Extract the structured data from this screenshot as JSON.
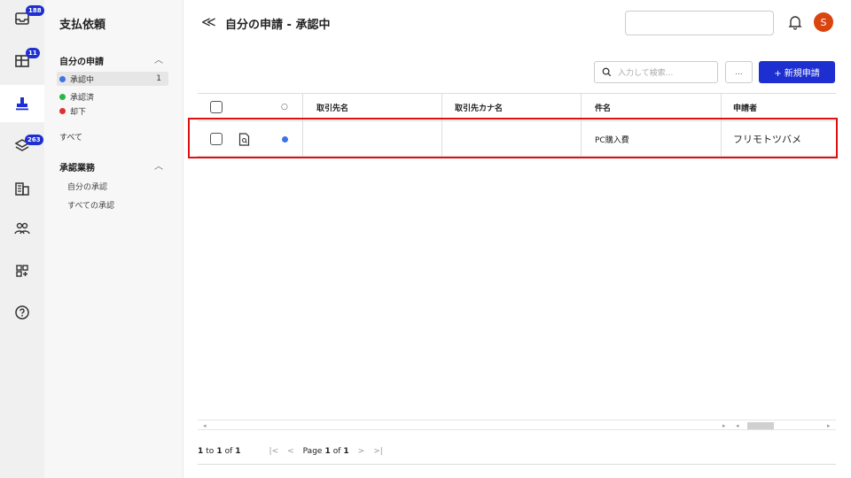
{
  "rail": {
    "badges": {
      "inbox": "188",
      "grid": "11",
      "layers": "263"
    }
  },
  "sidebar": {
    "title": "支払依頼",
    "section1": "自分の申請",
    "items": [
      {
        "label": "承認中",
        "count": "1",
        "color": "#3b73e8"
      },
      {
        "label": "承認済",
        "count": "",
        "color": "#2db34a"
      },
      {
        "label": "却下",
        "count": "",
        "color": "#e03030"
      }
    ],
    "all": "すべて",
    "section2": "承認業務",
    "sub": [
      "自分の承認",
      "すべての承認"
    ]
  },
  "header": {
    "back": "≪",
    "title": "自分の申請 - 承認中",
    "avatar": "S"
  },
  "toolbar": {
    "search_placeholder": "入力して検索...",
    "more": "...",
    "new_button": "+ 新規申請"
  },
  "table": {
    "columns": [
      "取引先名",
      "取引先カナ名",
      "件名",
      "申請者"
    ],
    "status_header": "○",
    "rows": [
      {
        "partner": "",
        "partner_kana": "",
        "subject": "PC購入費",
        "applicant": "フリモトツバメ",
        "status_color": "#3b73e8"
      }
    ]
  },
  "pager": {
    "range_a": "1",
    "range_to": "to",
    "range_b": "1",
    "range_of": "of",
    "range_total": "1",
    "first": "|<",
    "prev": "<",
    "page_label": "Page",
    "page_num": "1",
    "page_of": "of",
    "page_total": "1",
    "next": ">",
    "last": ">|"
  },
  "scroll": {
    "left": "◂",
    "right": "▸",
    "left2": "◂"
  }
}
